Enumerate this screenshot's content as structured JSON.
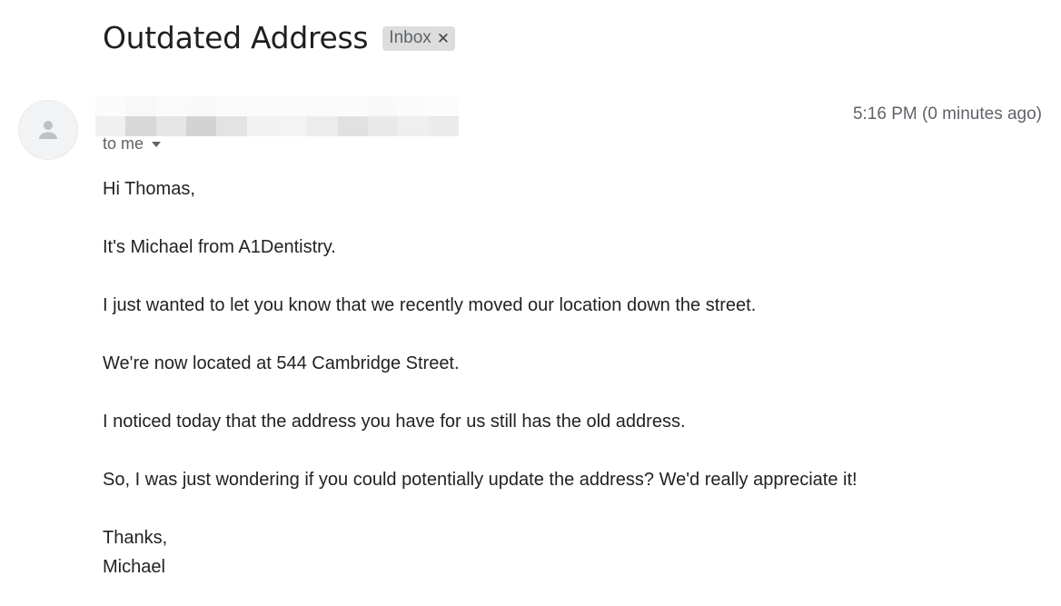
{
  "email": {
    "subject": "Outdated Address",
    "label": "Inbox",
    "label_remove_icon": "close-icon",
    "avatar_icon": "person-icon",
    "recipient_text": "to me",
    "recipient_toggle_icon": "caret-down-icon",
    "timestamp": "5:16 PM (0 minutes ago)",
    "body": {
      "greeting": "Hi Thomas,",
      "line1": "It's Michael from A1Dentistry.",
      "line2": "I just wanted to let you know that we recently moved our location down the street.",
      "line3": "We're now located at 544 Cambridge Street.",
      "line4": "I noticed today that the address you have for us still has the old address.",
      "line5": "So, I was just wondering if you could potentially update the address? We'd really appreciate it!",
      "signoff": "Thanks,",
      "signature": "Michael"
    }
  },
  "colors": {
    "subject_text": "#1f1f1f",
    "label_chip_bg": "#dddddd",
    "secondary_text": "#5f6368",
    "body_text": "#222222",
    "avatar_bg": "#f1f3f4"
  }
}
